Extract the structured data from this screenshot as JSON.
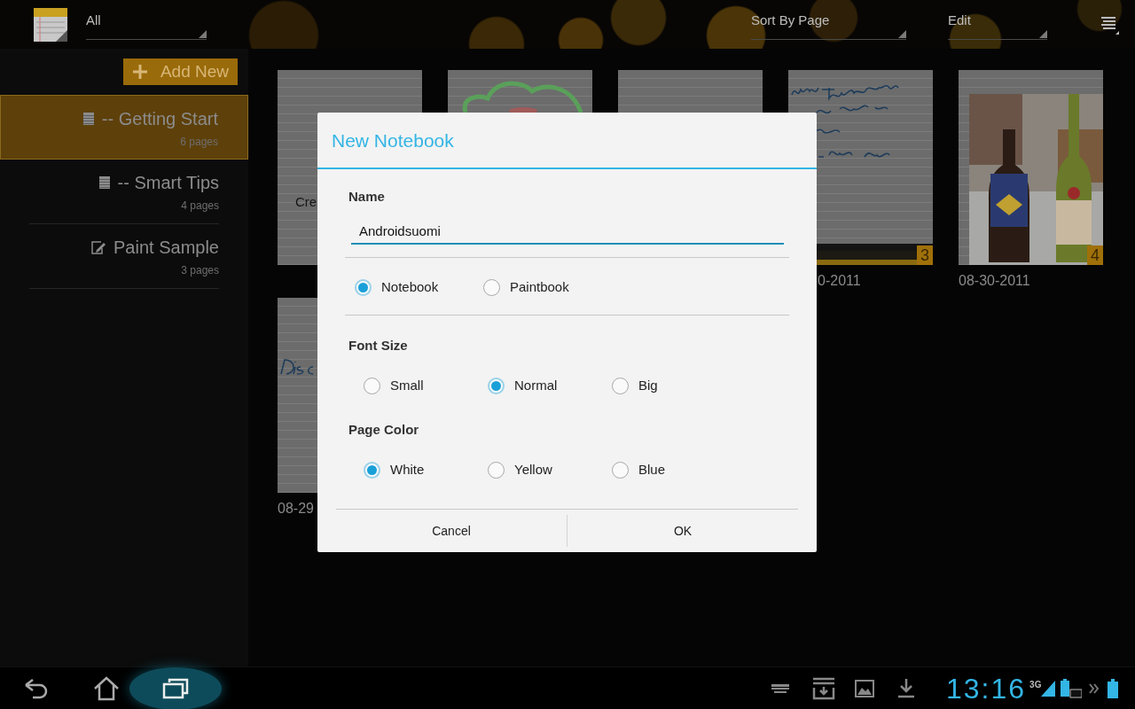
{
  "action_bar": {
    "filter": "All",
    "sort": "Sort By Page",
    "edit": "Edit"
  },
  "sidebar": {
    "add_button": "Add New",
    "items": [
      {
        "title": "-- Getting Start",
        "pages": "6 pages",
        "kind": "notebook",
        "selected": true
      },
      {
        "title": "-- Smart Tips",
        "pages": "4 pages",
        "kind": "notebook",
        "selected": false
      },
      {
        "title": "Paint Sample",
        "pages": "3 pages",
        "kind": "paintbook",
        "selected": false
      }
    ]
  },
  "thumbnails": [
    {
      "kind": "typed",
      "text": "Cre"
    },
    {
      "kind": "drawing"
    },
    {
      "kind": "blank"
    },
    {
      "kind": "handwriting",
      "badge": "3",
      "date": "0-2011",
      "date_partial": true
    },
    {
      "kind": "picture",
      "badge": "4",
      "date": "08-30-2011"
    },
    {
      "kind": "scribble",
      "date": "08-29"
    }
  ],
  "dialog": {
    "title": "New Notebook",
    "name_label": "Name",
    "name_value": "Androidsuomi",
    "type_options": [
      {
        "label": "Notebook",
        "selected": true
      },
      {
        "label": "Paintbook",
        "selected": false
      }
    ],
    "font_size": {
      "label": "Font Size",
      "options": [
        {
          "label": "Small",
          "selected": false
        },
        {
          "label": "Normal",
          "selected": true
        },
        {
          "label": "Big",
          "selected": false
        }
      ]
    },
    "page_color": {
      "label": "Page Color",
      "options": [
        {
          "label": "White",
          "selected": true
        },
        {
          "label": "Yellow",
          "selected": false
        },
        {
          "label": "Blue",
          "selected": false
        }
      ]
    },
    "buttons": [
      "Cancel",
      "OK"
    ]
  },
  "nav_bar": {
    "time": "13:16",
    "network": "3G"
  }
}
